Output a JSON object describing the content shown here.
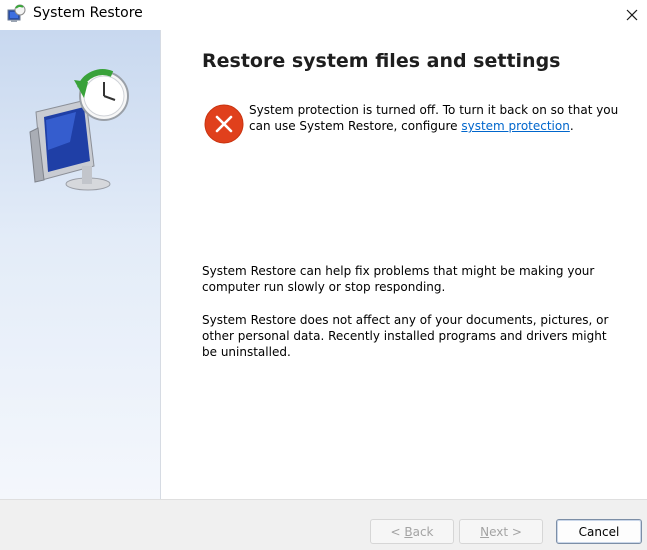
{
  "window": {
    "title": "System Restore",
    "close_symbol": "✕"
  },
  "page": {
    "title": "Restore system files and settings"
  },
  "error": {
    "icon": "error-icon",
    "text_before_link": "System protection is turned off. To turn it back on so that you can use System Restore, configure ",
    "link_text": "system protection",
    "text_after_link": "."
  },
  "info": {
    "paragraph_1": "System Restore can help fix problems that might be making your computer run slowly or stop responding.",
    "paragraph_2": "System Restore does not affect any of your documents, pictures, or other personal data. Recently installed programs and drivers might be uninstalled."
  },
  "buttons": {
    "back": {
      "prefix": "< ",
      "mnemonic": "B",
      "rest": "ack",
      "enabled": false
    },
    "next": {
      "mnemonic": "N",
      "rest": "ext >",
      "enabled": false
    },
    "cancel": {
      "label": "Cancel",
      "enabled": true
    }
  },
  "colors": {
    "link": "#0066cc",
    "error_red": "#e0401c",
    "sidebar_top": "#c8d8ef",
    "sidebar_bottom": "#f4f7fc",
    "footer_bg": "#f0f0f0"
  }
}
